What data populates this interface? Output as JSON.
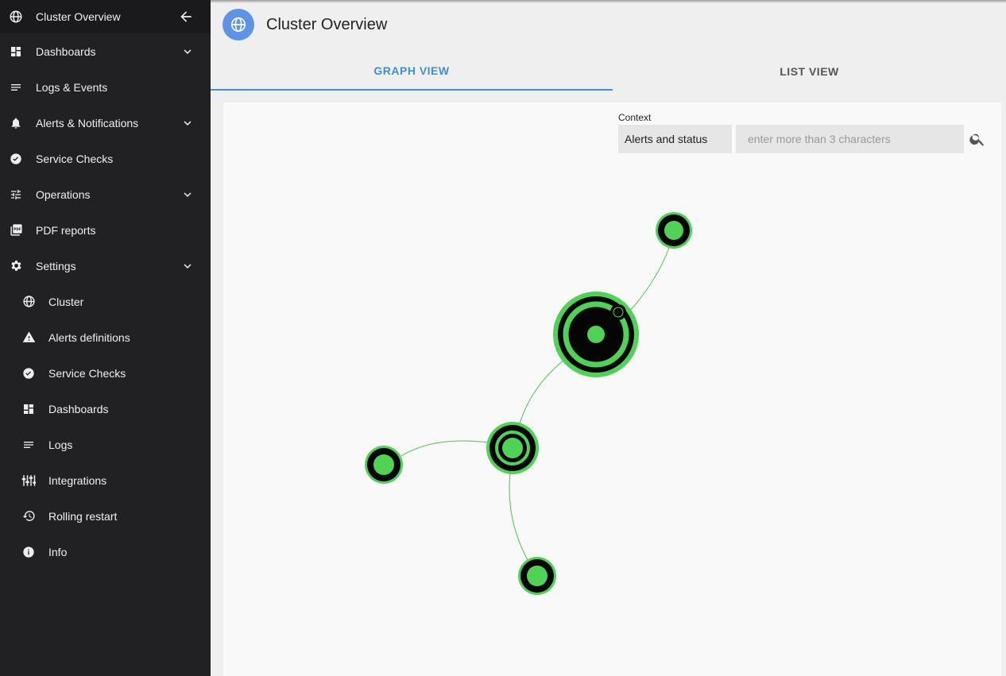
{
  "sidebar": {
    "header": {
      "label": "Cluster Overview",
      "icon": "globe-icon",
      "back_icon": "arrow-left-icon"
    },
    "items": [
      {
        "label": "Dashboards",
        "icon": "dashboard-icon",
        "expandable": true
      },
      {
        "label": "Logs & Events",
        "icon": "lines-icon",
        "expandable": false
      },
      {
        "label": "Alerts & Notifications",
        "icon": "bell-icon",
        "expandable": true
      },
      {
        "label": "Service Checks",
        "icon": "check-circle-icon",
        "expandable": false
      },
      {
        "label": "Operations",
        "icon": "sliders-icon",
        "expandable": true
      },
      {
        "label": "PDF reports",
        "icon": "pdf-icon",
        "expandable": false
      },
      {
        "label": "Settings",
        "icon": "gear-icon",
        "expandable": true
      }
    ],
    "sub_items": [
      {
        "label": "Cluster",
        "icon": "globe-icon"
      },
      {
        "label": "Alerts definitions",
        "icon": "warning-icon"
      },
      {
        "label": "Service Checks",
        "icon": "check-circle-icon"
      },
      {
        "label": "Dashboards",
        "icon": "dashboard-icon"
      },
      {
        "label": "Logs",
        "icon": "lines-icon"
      },
      {
        "label": "Integrations",
        "icon": "integrations-icon"
      },
      {
        "label": "Rolling restart",
        "icon": "restore-icon"
      },
      {
        "label": "Info",
        "icon": "info-icon"
      }
    ]
  },
  "header": {
    "title": "Cluster Overview",
    "icon": "globe-icon"
  },
  "tabs": [
    {
      "label": "GRAPH VIEW",
      "active": true
    },
    {
      "label": "LIST VIEW",
      "active": false
    }
  ],
  "context": {
    "label": "Context",
    "selected": "Alerts and status",
    "search_placeholder": "enter more than 3 characters",
    "search_value": ""
  },
  "colors": {
    "sidebar_bg": "#212124",
    "accent": "#3e8fdc",
    "node_green": "#4fd355",
    "node_black": "#050505",
    "edge": "#4fc24f"
  },
  "graph": {
    "nodes": [
      {
        "id": "cluster",
        "type": "cluster"
      },
      {
        "id": "hub",
        "type": "hub"
      },
      {
        "id": "node-top",
        "type": "leaf"
      },
      {
        "id": "node-left",
        "type": "leaf"
      },
      {
        "id": "node-bottom",
        "type": "leaf"
      }
    ],
    "edges": [
      [
        "cluster",
        "node-top"
      ],
      [
        "cluster",
        "hub"
      ],
      [
        "hub",
        "node-left"
      ],
      [
        "hub",
        "node-bottom"
      ]
    ]
  }
}
